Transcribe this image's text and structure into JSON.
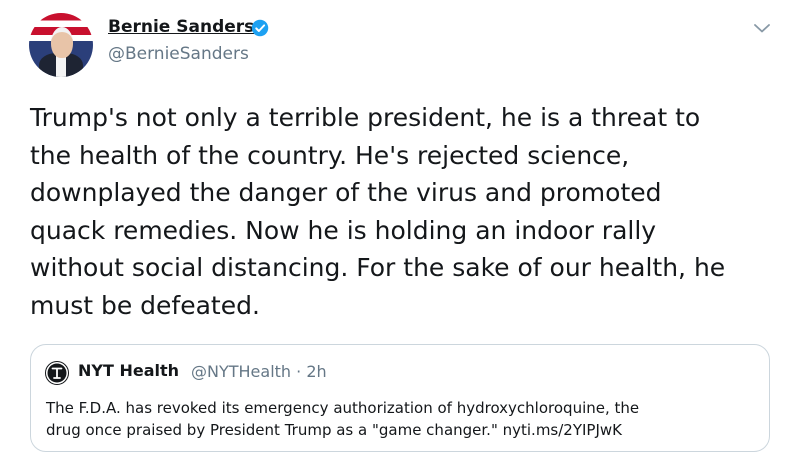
{
  "tweet": {
    "author_name": "Bernie Sanders",
    "author_handle": "@BernieSanders",
    "verified_icon": "verified-badge-icon",
    "menu_icon": "chevron-down-icon",
    "text": "Trump's not only a terrible president, he is a threat to\nthe health of the country. He's rejected science,\ndownplayed the danger of the virus and promoted\nquack remedies. Now he is holding an indoor rally\nwithout social distancing. For the sake of our health, he\nmust be defeated."
  },
  "quoted_tweet": {
    "logo_icon": "nyt-logo-icon",
    "author_name": "NYT Health",
    "author_handle_time": "@NYTHealth · 2h",
    "text": "The F.D.A. has revoked its emergency authorization of hydroxychloroquine, the\ndrug once praised by President Trump as a \"game changer.\" nyti.ms/2YIPJwK"
  },
  "colors": {
    "text_primary": "#14171a",
    "text_secondary": "#657786",
    "verified_blue": "#1da1f2",
    "card_border": "#ccd6dd"
  }
}
